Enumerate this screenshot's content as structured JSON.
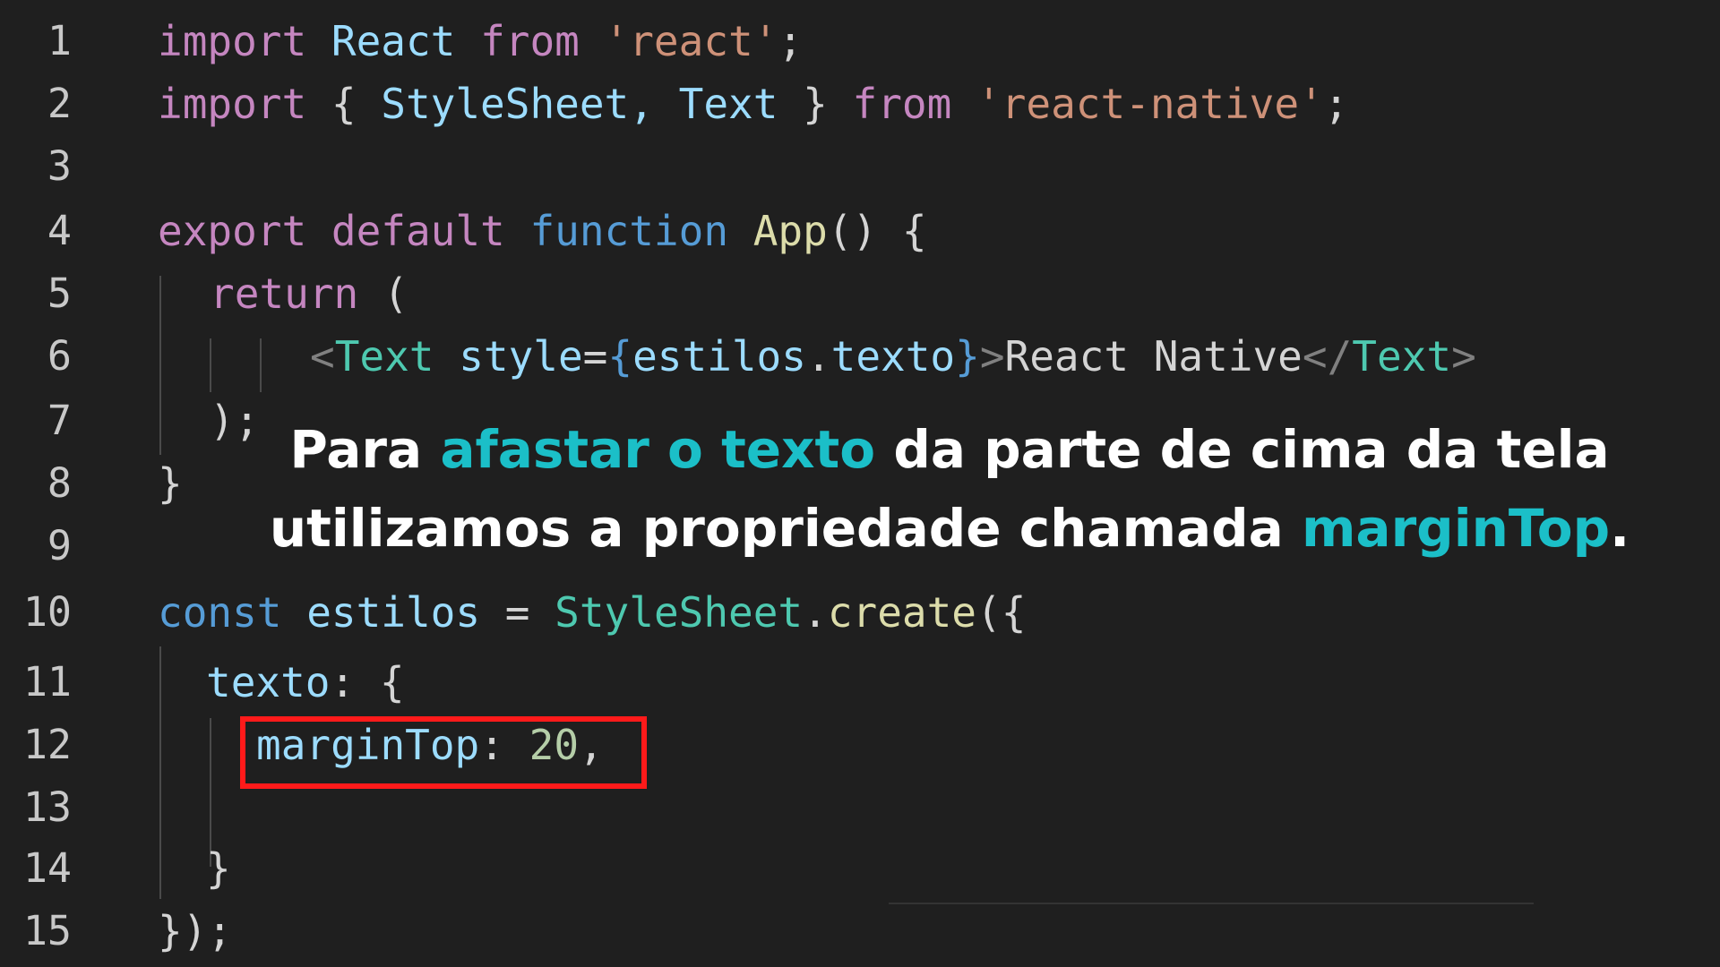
{
  "editor": {
    "line_numbers": [
      "1",
      "2",
      "3",
      "4",
      "5",
      "6",
      "7",
      "8",
      "9",
      "10",
      "11",
      "12",
      "13",
      "14",
      "15"
    ],
    "lines": {
      "l1": {
        "kw_import": "import",
        "react": "React",
        "kw_from": "from",
        "str": "'react'",
        "semi": ";"
      },
      "l2": {
        "kw_import": "import",
        "open": "{",
        "stylesheet": "StyleSheet,",
        "text": "Text",
        "close": "}",
        "kw_from": "from",
        "str": "'react-native'",
        "semi": ";"
      },
      "l4": {
        "kw_export": "export",
        "kw_default": "default",
        "kw_function": "function",
        "name": "App",
        "paren": "()",
        "brace": "{"
      },
      "l5": {
        "kw_return": "return",
        "paren": "("
      },
      "l6": {
        "lt": "<",
        "tag": "Text",
        "attr": "style",
        "eq": "=",
        "ob": "{",
        "expr_obj": "estilos",
        "dot": ".",
        "expr_prop": "texto",
        "cb": "}",
        "gt": ">",
        "content": "React Native",
        "lt_close": "</",
        "tag_close": "Text",
        "gt_close": ">"
      },
      "l7": {
        "text": ");"
      },
      "l8": {
        "text": "}"
      },
      "l10": {
        "kw_const": "const",
        "name": "estilos",
        "eq": "=",
        "obj": "StyleSheet",
        "dot": ".",
        "method": "create",
        "paren": "(",
        "brace": "{"
      },
      "l11": {
        "prop": "texto",
        "colon": ":",
        "brace": "{"
      },
      "l12": {
        "prop": "marginTop",
        "colon": ":",
        "value": "20",
        "comma": ","
      },
      "l14": {
        "text": "}"
      },
      "l15": {
        "brace": "}",
        "paren": ")",
        "semi": ";"
      }
    }
  },
  "caption": {
    "line1_a": "Para ",
    "line1_accent": "afastar o texto",
    "line1_b": " da parte de cima da tela",
    "line2_a": "utilizamos a propriedade chamada ",
    "line2_accent": "marginTop",
    "line2_b": "."
  },
  "colors": {
    "background": "#1f1f1f",
    "accent": "#1bbfc8",
    "highlight_border": "#ff1a1a"
  }
}
